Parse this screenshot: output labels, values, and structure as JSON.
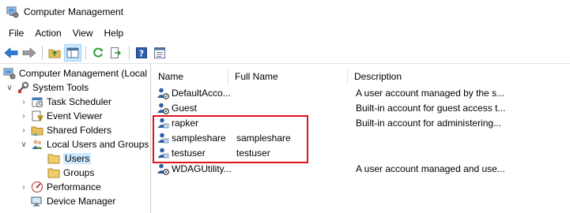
{
  "window": {
    "title": "Computer Management"
  },
  "menu": [
    "File",
    "Action",
    "View",
    "Help"
  ],
  "toolbar": {
    "buttons": [
      "back-icon",
      "forward-icon",
      "up-folder-icon",
      "show-hide-tree-icon",
      "refresh-icon",
      "export-list-icon",
      "help-icon",
      "properties-icon"
    ]
  },
  "tree": {
    "items": [
      {
        "label": "Computer Management (Local",
        "icon": "computer-management-icon",
        "level": 0,
        "expander": "none"
      },
      {
        "label": "System Tools",
        "icon": "system-tools-icon",
        "level": 1,
        "expander": "expanded"
      },
      {
        "label": "Task Scheduler",
        "icon": "task-scheduler-icon",
        "level": 2,
        "expander": "collapsed"
      },
      {
        "label": "Event Viewer",
        "icon": "event-viewer-icon",
        "level": 2,
        "expander": "collapsed"
      },
      {
        "label": "Shared Folders",
        "icon": "shared-folders-icon",
        "level": 2,
        "expander": "collapsed"
      },
      {
        "label": "Local Users and Groups",
        "icon": "local-users-groups-icon",
        "level": 2,
        "expander": "expanded"
      },
      {
        "label": "Users",
        "icon": "folder-icon",
        "level": 3,
        "expander": "none",
        "selected": true
      },
      {
        "label": "Groups",
        "icon": "folder-icon",
        "level": 3,
        "expander": "none"
      },
      {
        "label": "Performance",
        "icon": "performance-icon",
        "level": 2,
        "expander": "collapsed"
      },
      {
        "label": "Device Manager",
        "icon": "device-manager-icon",
        "level": 2,
        "expander": "none"
      }
    ]
  },
  "list": {
    "columns": [
      "Name",
      "Full Name",
      "Description"
    ],
    "rows": [
      {
        "name": "DefaultAcco...",
        "full_name": "",
        "description": "A user account managed by the s..."
      },
      {
        "name": "Guest",
        "full_name": "",
        "description": "Built-in account for guest access t..."
      },
      {
        "name": "rapker",
        "full_name": "",
        "description": "Built-in account for administering..."
      },
      {
        "name": "sampleshare",
        "full_name": "sampleshare",
        "description": ""
      },
      {
        "name": "testuser",
        "full_name": "testuser",
        "description": ""
      },
      {
        "name": "WDAGUtility...",
        "full_name": "",
        "description": "A user account managed and use..."
      }
    ]
  },
  "colors": {
    "highlight_border": "#e0121b",
    "selection": "#cce8ff"
  }
}
